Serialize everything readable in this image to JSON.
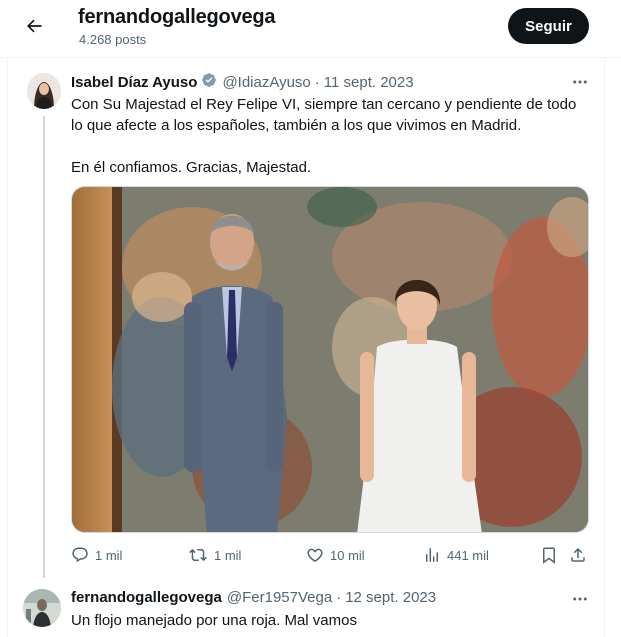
{
  "header": {
    "username": "fernandogallegovega",
    "post_count": "4.268 posts",
    "follow_label": "Seguir"
  },
  "tweet": {
    "display_name": "Isabel Díaz Ayuso",
    "handle": "@IdiazAyuso",
    "separator": "·",
    "date": "11 sept. 2023",
    "text_line1": "Con Su Majestad el Rey Felipe VI, siempre tan cercano y pendiente de todo",
    "text_line2": "lo que afecte a los españoles, también a los que vivimos en Madrid.",
    "text_line3": "En él confiamos. Gracias, Majestad.",
    "actions": {
      "replies": "1 mil",
      "reposts": "1 mil",
      "likes": "10 mil",
      "views": "441 mil"
    }
  },
  "reply": {
    "display_name": "fernandogallegovega",
    "handle": "@Fer1957Vega",
    "separator": "·",
    "date": "12 sept. 2023",
    "text": "Un flojo manejado por una roja. Mal vamos"
  },
  "colors": {
    "text_primary": "#0f1419",
    "text_secondary": "#536471",
    "verified": "#829aab",
    "follow_bg": "#0f1419"
  }
}
